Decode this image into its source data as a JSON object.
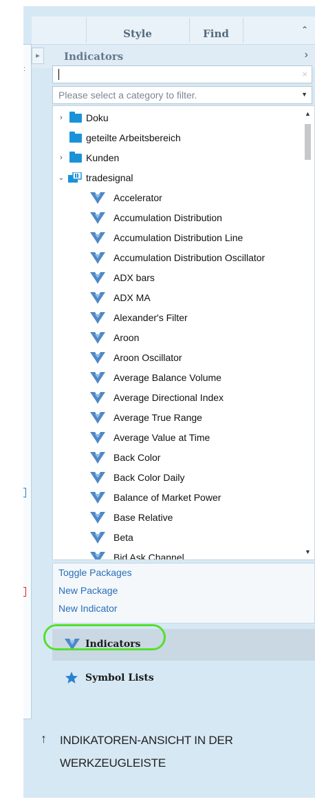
{
  "tabs": [
    {
      "label": ""
    },
    {
      "label": "Style"
    },
    {
      "label": "Find"
    }
  ],
  "panel": {
    "title": "Indicators",
    "search_value": "",
    "filter_placeholder": "Please select a category to filter."
  },
  "tree": {
    "folders": [
      {
        "label": "Doku",
        "expanded": false
      },
      {
        "label": "geteilte Arbeitsbereich",
        "expanded": null
      },
      {
        "label": "Kunden",
        "expanded": false
      },
      {
        "label": "tradesignal",
        "expanded": true
      }
    ],
    "indicators": [
      "Accelerator",
      "Accumulation Distribution",
      "Accumulation Distribution Line",
      "Accumulation Distribution Oscillator",
      "ADX bars",
      "ADX MA",
      "Alexander's Filter",
      "Aroon",
      "Aroon Oscillator",
      "Average Balance Volume",
      "Average Directional Index",
      "Average True Range",
      "Average Value at Time",
      "Back Color",
      "Back Color Daily",
      "Balance of Market Power",
      "Base Relative",
      "Beta",
      "Bid Ask Channel"
    ]
  },
  "actions": [
    "Toggle Packages",
    "New Package",
    "New Indicator"
  ],
  "nav": {
    "indicators": "Indicators",
    "symbol_lists": "Symbol Lists"
  },
  "caption": "INDIKATOREN-ANSICHT IN DER WERKZEUGLEISTE",
  "colors": {
    "panel_bg": "#d6e8f4",
    "folder": "#1a92d8",
    "link": "#2a6db8",
    "highlight": "#52e02c"
  }
}
